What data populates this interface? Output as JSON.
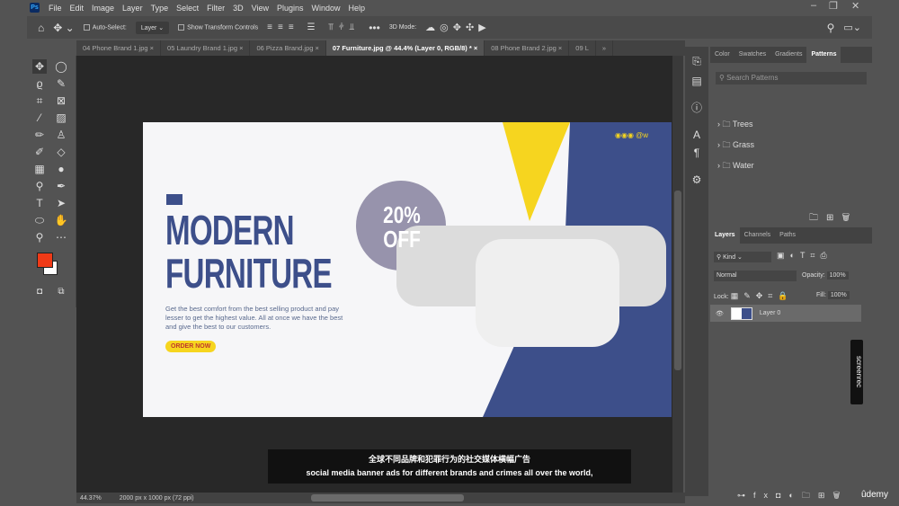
{
  "menu": {
    "app_icon": "Ps",
    "items": [
      "File",
      "Edit",
      "Image",
      "Layer",
      "Type",
      "Select",
      "Filter",
      "3D",
      "View",
      "Plugins",
      "Window",
      "Help"
    ]
  },
  "options": {
    "auto_select": "Auto-Select:",
    "layer_select": "Layer",
    "show_transform": "Show Transform Controls",
    "mode_3d": "3D Mode:"
  },
  "tabs": [
    "04 Phone Brand 1.jpg",
    "05 Laundry Brand 1.jpg",
    "06 Pizza Brand.jpg",
    "07 Furniture.jpg @ 44.4% (Layer 0, RGB/8) *",
    "08 Phone Brand 2.jpg",
    "09 L"
  ],
  "artwork": {
    "title1": "MODERN",
    "title2": "FURNITURE",
    "body": "Get the best comfort from the best selling product and pay lesser to get the highest value. All at once we have the best and give the best to our customers.",
    "cta": "ORDER NOW",
    "badge1": "20%",
    "badge2": "OFF",
    "social": "@w"
  },
  "status": {
    "zoom": "44.37%",
    "doc": "2000 px x 1000 px (72 ppi)"
  },
  "patterns": {
    "tabs": [
      "Color",
      "Swatches",
      "Gradients",
      "Patterns"
    ],
    "search_placeholder": "Search Patterns",
    "folders": [
      "Trees",
      "Grass",
      "Water"
    ]
  },
  "layers": {
    "tabs": [
      "Layers",
      "Channels",
      "Paths"
    ],
    "kind": "Kind",
    "blend": "Normal",
    "opacity_label": "Opacity:",
    "opacity": "100%",
    "lock_label": "Lock:",
    "fill_label": "Fill:",
    "fill": "100%",
    "layer_name": "Layer 0"
  },
  "subtitles": {
    "zh": "全球不同品牌和犯罪行为的社交媒体横幅广告",
    "en": "social media banner ads for different brands and crimes all over the world,"
  },
  "watermarks": {
    "screenrec": "screenrec",
    "udemy": "ûdemy"
  },
  "colors": {
    "blue": "#3d4f8a",
    "yellow": "#f6d51f",
    "foreground": "#f03a17",
    "background": "#ffffff"
  }
}
